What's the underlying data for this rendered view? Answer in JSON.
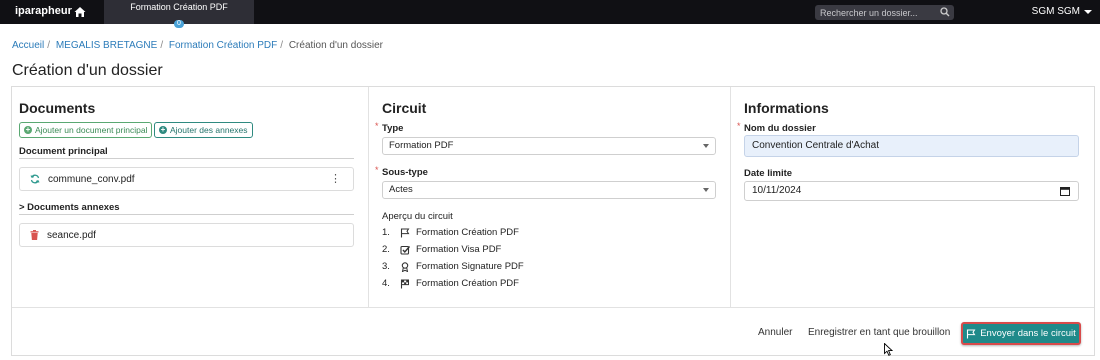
{
  "topbar": {
    "brand": "iparapheur",
    "active_tab": {
      "label": "Formation Création PDF",
      "badge": "0"
    },
    "search_placeholder": "Rechercher un dossier...",
    "user": "SGM SGM"
  },
  "breadcrumb": [
    "Accueil",
    "MEGALIS BRETAGNE",
    "Formation Création PDF",
    "Création d'un dossier"
  ],
  "page_title": "Création d'un dossier",
  "documents": {
    "heading": "Documents",
    "add_main_label": "Ajouter un document principal",
    "add_annexes_label": "Ajouter des annexes",
    "main_section_label": "Document principal",
    "main_file": "commune_conv.pdf",
    "annexes_section_label": "> Documents annexes",
    "annex_file": "seance.pdf"
  },
  "circuit": {
    "heading": "Circuit",
    "type_label": "Type",
    "type_value": "Formation PDF",
    "subtype_label": "Sous-type",
    "subtype_value": "Actes",
    "preview_label": "Aperçu du circuit",
    "steps": [
      {
        "num": "1.",
        "icon": "flag-icon",
        "label": "Formation Création PDF"
      },
      {
        "num": "2.",
        "icon": "check-square-icon",
        "label": "Formation Visa PDF"
      },
      {
        "num": "3.",
        "icon": "award-icon",
        "label": "Formation Signature PDF"
      },
      {
        "num": "4.",
        "icon": "finish-flag-icon",
        "label": "Formation Création PDF"
      }
    ]
  },
  "informations": {
    "heading": "Informations",
    "name_label": "Nom du dossier",
    "name_value": "Convention Centrale d'Achat",
    "date_label": "Date limite",
    "date_value": "10/11/2024"
  },
  "footer": {
    "cancel_label": "Annuler",
    "draft_label": "Enregistrer en tant que brouillon",
    "send_label": "Envoyer dans le circuit"
  },
  "colors": {
    "topbar_bg": "#101014",
    "link": "#2b7bb9",
    "primary": "#1f8a8a",
    "highlight_border": "#d84b4b",
    "required": "#d9534f"
  }
}
